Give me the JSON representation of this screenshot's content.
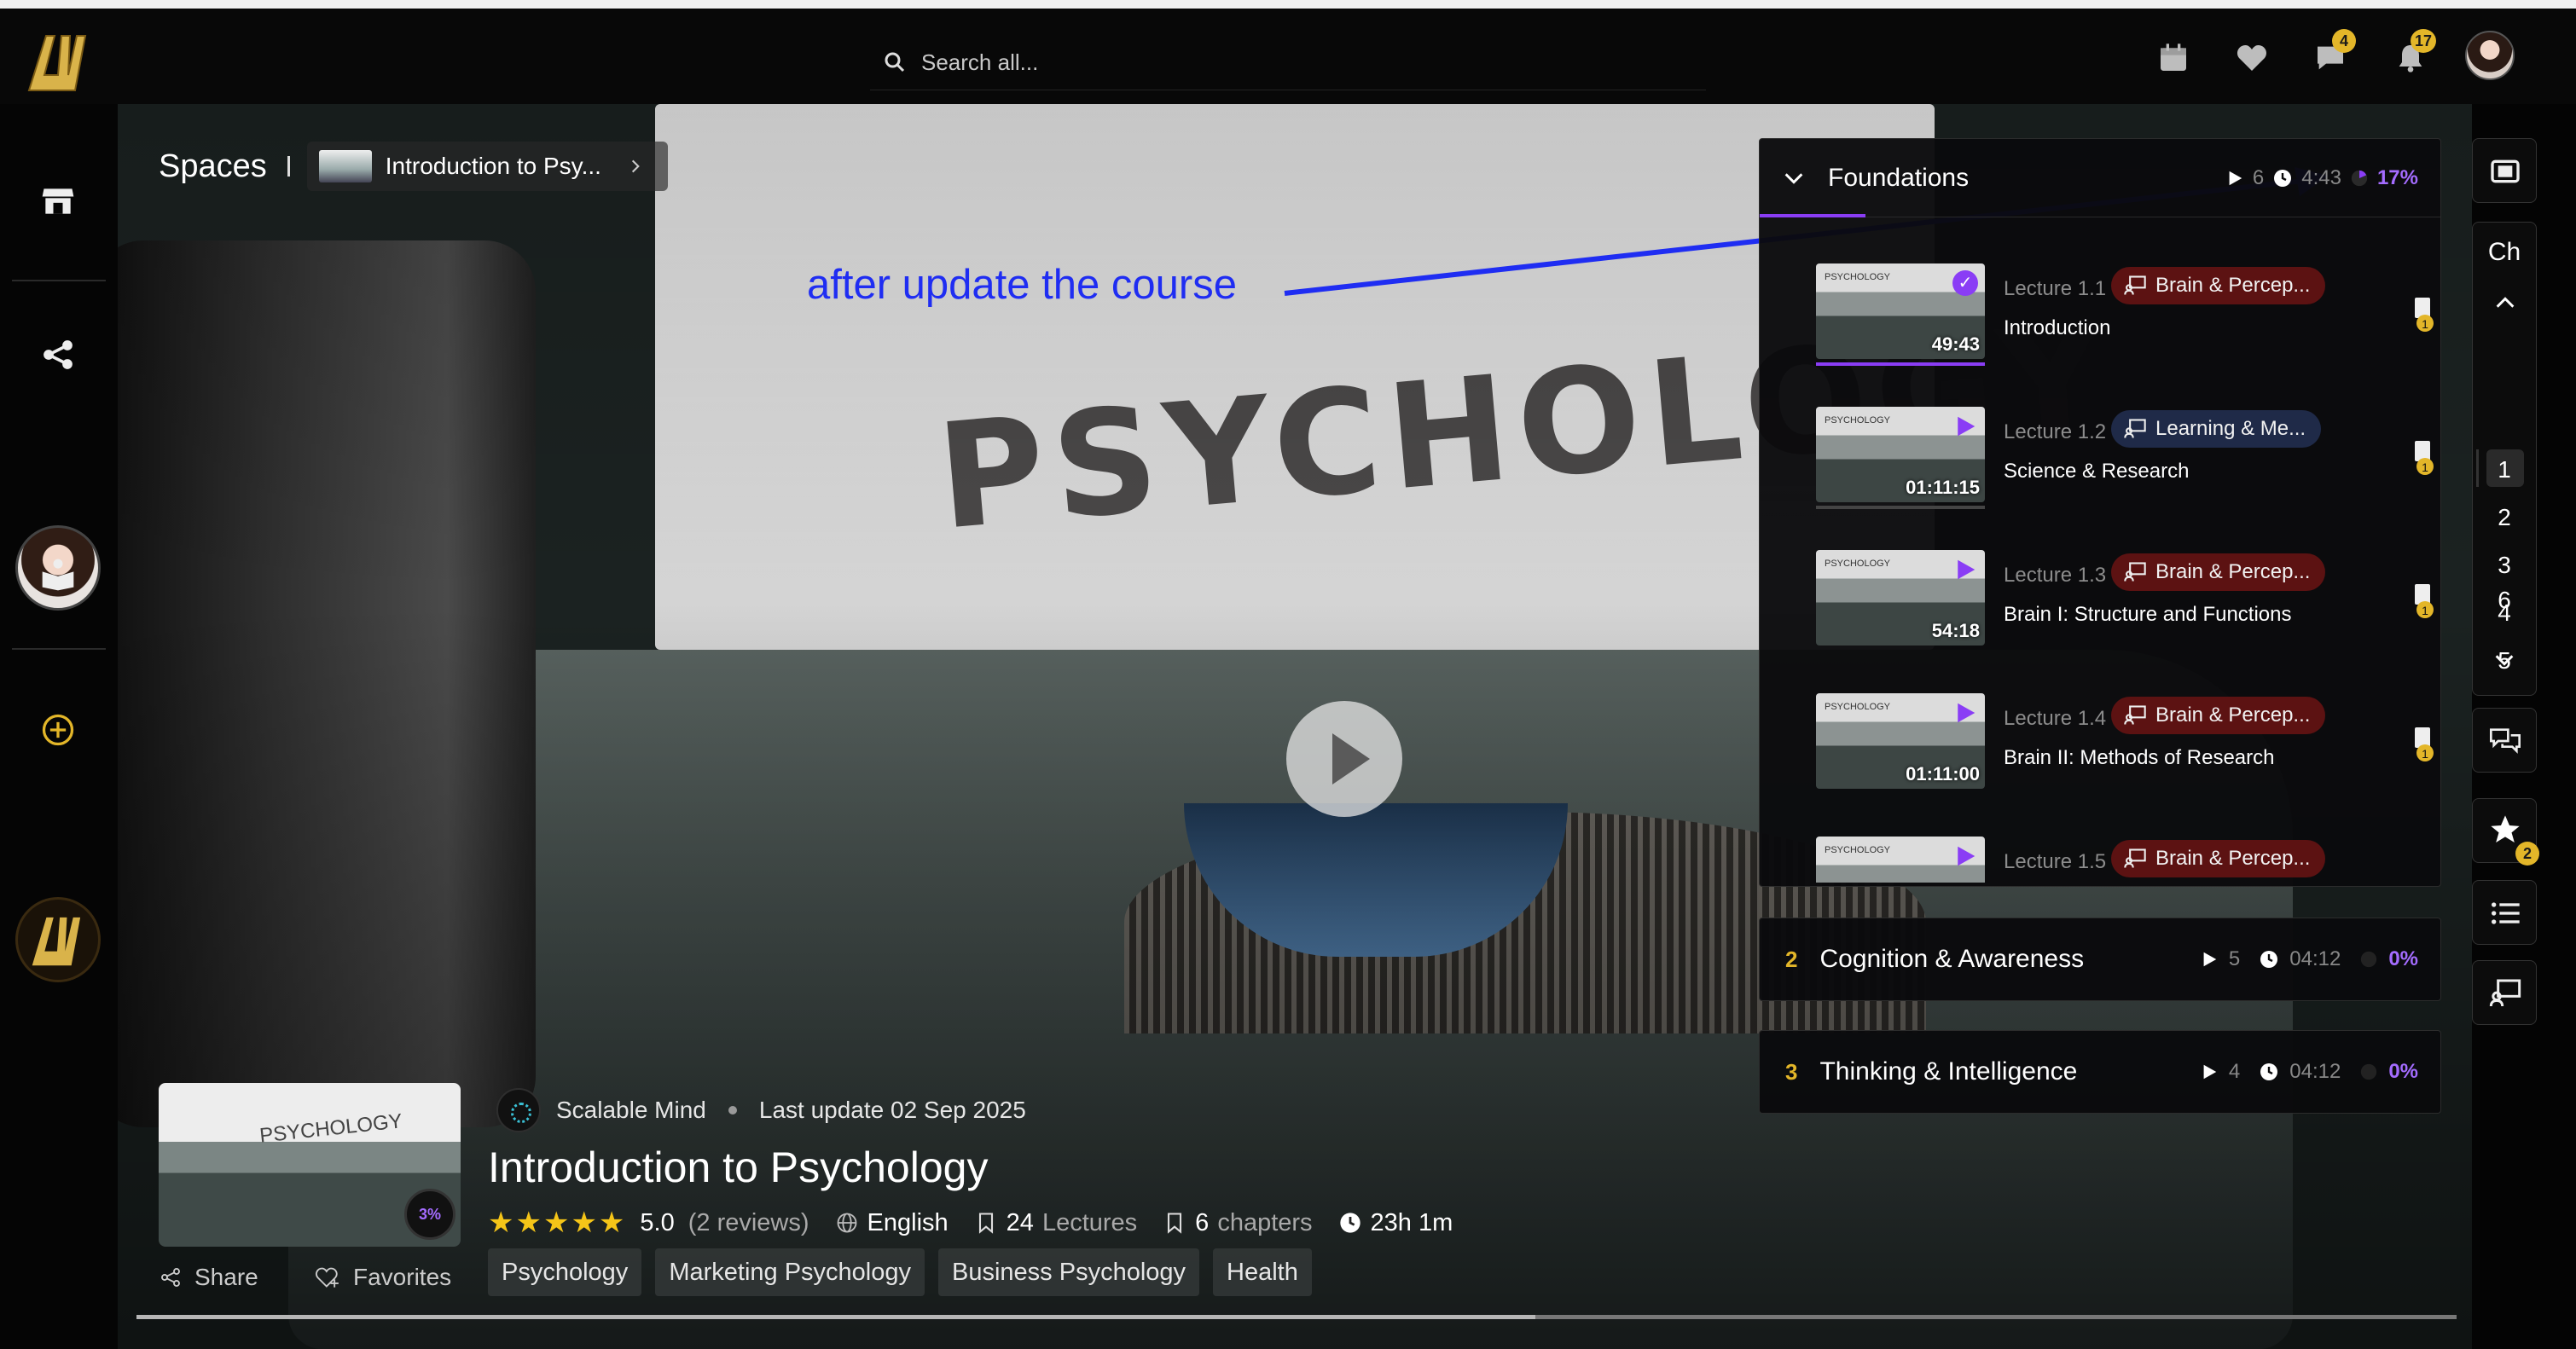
{
  "header": {
    "search_placeholder": "Search all...",
    "messages_badge": "4",
    "notifications_badge": "17"
  },
  "breadcrumb": {
    "root": "Spaces",
    "current": "Introduction to Psy..."
  },
  "annotation": "after update the course",
  "course": {
    "instructor": "Scalable Mind",
    "last_update": "Last update 02 Sep 2025",
    "title": "Introduction to Psychology",
    "rating": "5.0",
    "reviews": "(2 reviews)",
    "language": "English",
    "lectures_count": "24",
    "lectures_label": "Lectures",
    "chapters_count": "6",
    "chapters_label": "chapters",
    "duration": "23h 1m",
    "progress": "3%",
    "share_label": "Share",
    "favorites_label": "Favorites",
    "tags": [
      "Psychology",
      "Marketing Psychology",
      "Business Psychology",
      "Health"
    ]
  },
  "playlist": {
    "chapter_title": "Foundations",
    "chapter_lectures": "6",
    "chapter_duration": "4:43",
    "chapter_progress": "17%",
    "lectures": [
      {
        "number": "Lecture 1.1",
        "tag": "Brain & Percep...",
        "tag_color": "red",
        "title": "Introduction",
        "duration": "49:43",
        "done": true
      },
      {
        "number": "Lecture 1.2",
        "tag": "Learning & Me...",
        "tag_color": "blue",
        "title": "Science & Research",
        "duration": "01:11:15",
        "done": false
      },
      {
        "number": "Lecture 1.3",
        "tag": "Brain & Percep...",
        "tag_color": "red",
        "title": "Brain I: Structure and Functions",
        "duration": "54:18",
        "done": false
      },
      {
        "number": "Lecture 1.4",
        "tag": "Brain & Percep...",
        "tag_color": "red",
        "title": "Brain II: Methods of Research",
        "duration": "01:11:00",
        "done": false
      },
      {
        "number": "Lecture 1.5",
        "tag": "Brain & Percep...",
        "tag_color": "red",
        "title": "",
        "duration": "",
        "done": false
      }
    ],
    "resource_count": "1",
    "thumb_label": "PSYCHOLOGY",
    "chapters": [
      {
        "num": "2",
        "title": "Cognition & Awareness",
        "lectures": "5",
        "duration": "04:12",
        "progress": "0%"
      },
      {
        "num": "3",
        "title": "Thinking & Intelligence",
        "lectures": "4",
        "duration": "04:12",
        "progress": "0%"
      }
    ]
  },
  "chapter_nav": {
    "label": "Ch",
    "numbers": [
      "1",
      "2",
      "3",
      "4",
      "5",
      "6"
    ],
    "active": "1",
    "favorites_badge": "2"
  },
  "hero_text": "PSYCHOLOGY",
  "colors": {
    "accent": "#8a3df5",
    "gold": "#e3b629",
    "annotation": "#1f2df2",
    "tag_red": "#5c1212",
    "tag_blue": "#1f2a48"
  }
}
